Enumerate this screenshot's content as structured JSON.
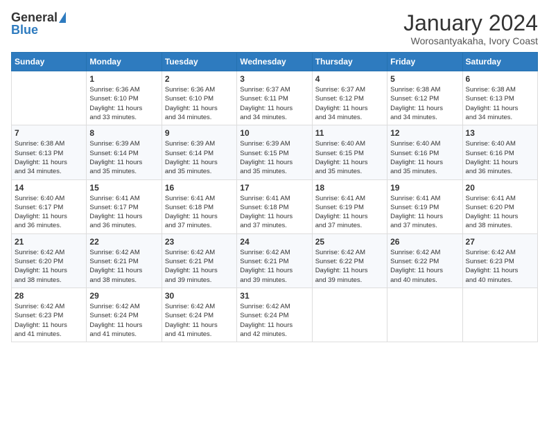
{
  "logo": {
    "general": "General",
    "blue": "Blue"
  },
  "header": {
    "month": "January 2024",
    "location": "Worosantyakaha, Ivory Coast"
  },
  "weekdays": [
    "Sunday",
    "Monday",
    "Tuesday",
    "Wednesday",
    "Thursday",
    "Friday",
    "Saturday"
  ],
  "weeks": [
    [
      {
        "day": "",
        "lines": []
      },
      {
        "day": "1",
        "lines": [
          "Sunrise: 6:36 AM",
          "Sunset: 6:10 PM",
          "Daylight: 11 hours",
          "and 33 minutes."
        ]
      },
      {
        "day": "2",
        "lines": [
          "Sunrise: 6:36 AM",
          "Sunset: 6:10 PM",
          "Daylight: 11 hours",
          "and 34 minutes."
        ]
      },
      {
        "day": "3",
        "lines": [
          "Sunrise: 6:37 AM",
          "Sunset: 6:11 PM",
          "Daylight: 11 hours",
          "and 34 minutes."
        ]
      },
      {
        "day": "4",
        "lines": [
          "Sunrise: 6:37 AM",
          "Sunset: 6:12 PM",
          "Daylight: 11 hours",
          "and 34 minutes."
        ]
      },
      {
        "day": "5",
        "lines": [
          "Sunrise: 6:38 AM",
          "Sunset: 6:12 PM",
          "Daylight: 11 hours",
          "and 34 minutes."
        ]
      },
      {
        "day": "6",
        "lines": [
          "Sunrise: 6:38 AM",
          "Sunset: 6:13 PM",
          "Daylight: 11 hours",
          "and 34 minutes."
        ]
      }
    ],
    [
      {
        "day": "7",
        "lines": [
          "Sunrise: 6:38 AM",
          "Sunset: 6:13 PM",
          "Daylight: 11 hours",
          "and 34 minutes."
        ]
      },
      {
        "day": "8",
        "lines": [
          "Sunrise: 6:39 AM",
          "Sunset: 6:14 PM",
          "Daylight: 11 hours",
          "and 35 minutes."
        ]
      },
      {
        "day": "9",
        "lines": [
          "Sunrise: 6:39 AM",
          "Sunset: 6:14 PM",
          "Daylight: 11 hours",
          "and 35 minutes."
        ]
      },
      {
        "day": "10",
        "lines": [
          "Sunrise: 6:39 AM",
          "Sunset: 6:15 PM",
          "Daylight: 11 hours",
          "and 35 minutes."
        ]
      },
      {
        "day": "11",
        "lines": [
          "Sunrise: 6:40 AM",
          "Sunset: 6:15 PM",
          "Daylight: 11 hours",
          "and 35 minutes."
        ]
      },
      {
        "day": "12",
        "lines": [
          "Sunrise: 6:40 AM",
          "Sunset: 6:16 PM",
          "Daylight: 11 hours",
          "and 35 minutes."
        ]
      },
      {
        "day": "13",
        "lines": [
          "Sunrise: 6:40 AM",
          "Sunset: 6:16 PM",
          "Daylight: 11 hours",
          "and 36 minutes."
        ]
      }
    ],
    [
      {
        "day": "14",
        "lines": [
          "Sunrise: 6:40 AM",
          "Sunset: 6:17 PM",
          "Daylight: 11 hours",
          "and 36 minutes."
        ]
      },
      {
        "day": "15",
        "lines": [
          "Sunrise: 6:41 AM",
          "Sunset: 6:17 PM",
          "Daylight: 11 hours",
          "and 36 minutes."
        ]
      },
      {
        "day": "16",
        "lines": [
          "Sunrise: 6:41 AM",
          "Sunset: 6:18 PM",
          "Daylight: 11 hours",
          "and 37 minutes."
        ]
      },
      {
        "day": "17",
        "lines": [
          "Sunrise: 6:41 AM",
          "Sunset: 6:18 PM",
          "Daylight: 11 hours",
          "and 37 minutes."
        ]
      },
      {
        "day": "18",
        "lines": [
          "Sunrise: 6:41 AM",
          "Sunset: 6:19 PM",
          "Daylight: 11 hours",
          "and 37 minutes."
        ]
      },
      {
        "day": "19",
        "lines": [
          "Sunrise: 6:41 AM",
          "Sunset: 6:19 PM",
          "Daylight: 11 hours",
          "and 37 minutes."
        ]
      },
      {
        "day": "20",
        "lines": [
          "Sunrise: 6:41 AM",
          "Sunset: 6:20 PM",
          "Daylight: 11 hours",
          "and 38 minutes."
        ]
      }
    ],
    [
      {
        "day": "21",
        "lines": [
          "Sunrise: 6:42 AM",
          "Sunset: 6:20 PM",
          "Daylight: 11 hours",
          "and 38 minutes."
        ]
      },
      {
        "day": "22",
        "lines": [
          "Sunrise: 6:42 AM",
          "Sunset: 6:21 PM",
          "Daylight: 11 hours",
          "and 38 minutes."
        ]
      },
      {
        "day": "23",
        "lines": [
          "Sunrise: 6:42 AM",
          "Sunset: 6:21 PM",
          "Daylight: 11 hours",
          "and 39 minutes."
        ]
      },
      {
        "day": "24",
        "lines": [
          "Sunrise: 6:42 AM",
          "Sunset: 6:21 PM",
          "Daylight: 11 hours",
          "and 39 minutes."
        ]
      },
      {
        "day": "25",
        "lines": [
          "Sunrise: 6:42 AM",
          "Sunset: 6:22 PM",
          "Daylight: 11 hours",
          "and 39 minutes."
        ]
      },
      {
        "day": "26",
        "lines": [
          "Sunrise: 6:42 AM",
          "Sunset: 6:22 PM",
          "Daylight: 11 hours",
          "and 40 minutes."
        ]
      },
      {
        "day": "27",
        "lines": [
          "Sunrise: 6:42 AM",
          "Sunset: 6:23 PM",
          "Daylight: 11 hours",
          "and 40 minutes."
        ]
      }
    ],
    [
      {
        "day": "28",
        "lines": [
          "Sunrise: 6:42 AM",
          "Sunset: 6:23 PM",
          "Daylight: 11 hours",
          "and 41 minutes."
        ]
      },
      {
        "day": "29",
        "lines": [
          "Sunrise: 6:42 AM",
          "Sunset: 6:24 PM",
          "Daylight: 11 hours",
          "and 41 minutes."
        ]
      },
      {
        "day": "30",
        "lines": [
          "Sunrise: 6:42 AM",
          "Sunset: 6:24 PM",
          "Daylight: 11 hours",
          "and 41 minutes."
        ]
      },
      {
        "day": "31",
        "lines": [
          "Sunrise: 6:42 AM",
          "Sunset: 6:24 PM",
          "Daylight: 11 hours",
          "and 42 minutes."
        ]
      },
      {
        "day": "",
        "lines": []
      },
      {
        "day": "",
        "lines": []
      },
      {
        "day": "",
        "lines": []
      }
    ]
  ]
}
